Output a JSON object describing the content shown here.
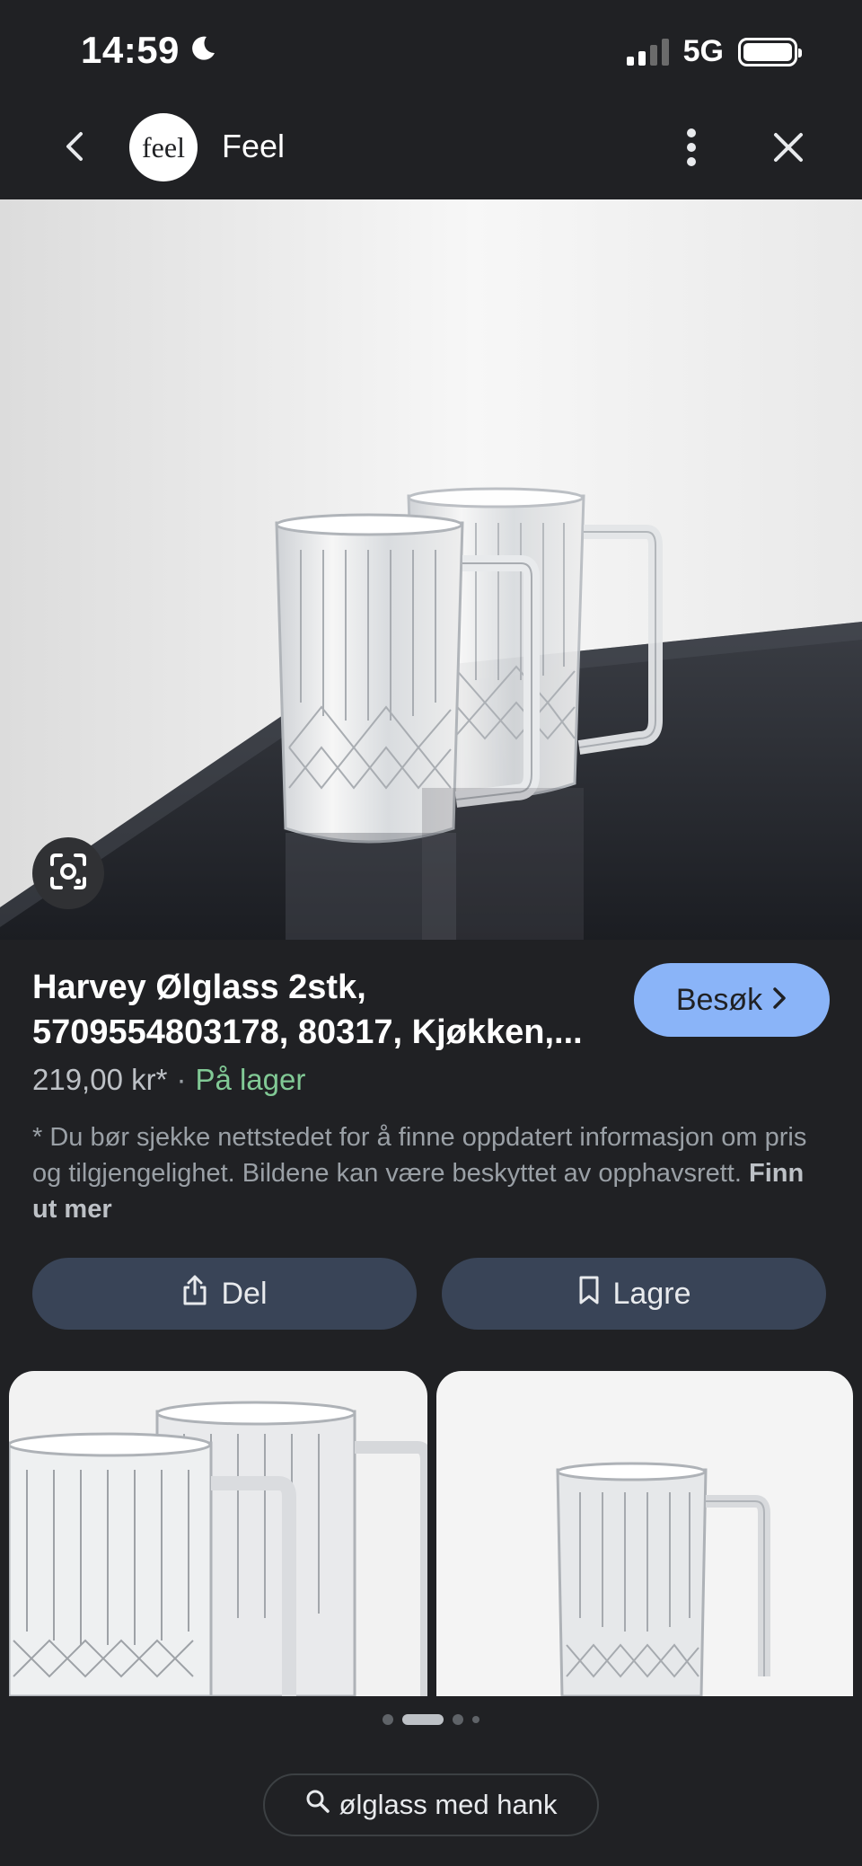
{
  "status_bar": {
    "time": "14:59",
    "network": "5G"
  },
  "header": {
    "site_logo_text": "feel",
    "site_name": "Feel"
  },
  "product": {
    "title_line1": "Harvey Ølglass 2stk,",
    "title_line2": "5709554803178, 80317, Kjøkken,...",
    "visit_label": "Besøk",
    "price": "219,00 kr*",
    "separator": "·",
    "stock_status": "På lager",
    "disclaimer": "* Du bør sjekke nettstedet for å finne oppdatert informasjon om pris og tilgjengelighet. Bildene kan være beskyttet av opphavsrett.",
    "learn_more": "Finn ut mer"
  },
  "actions": {
    "share_label": "Del",
    "save_label": "Lagre"
  },
  "search": {
    "query": "ølglass med hank"
  },
  "colors": {
    "background": "#202124",
    "accent": "#8ab4f8",
    "stock_green": "#81c995",
    "action_button": "#394457"
  },
  "icons": [
    "moon-icon",
    "signal-icon",
    "battery-icon",
    "back-arrow-icon",
    "more-vert-icon",
    "close-icon",
    "lens-icon",
    "chevron-right-icon",
    "share-icon",
    "bookmark-icon",
    "search-icon"
  ]
}
